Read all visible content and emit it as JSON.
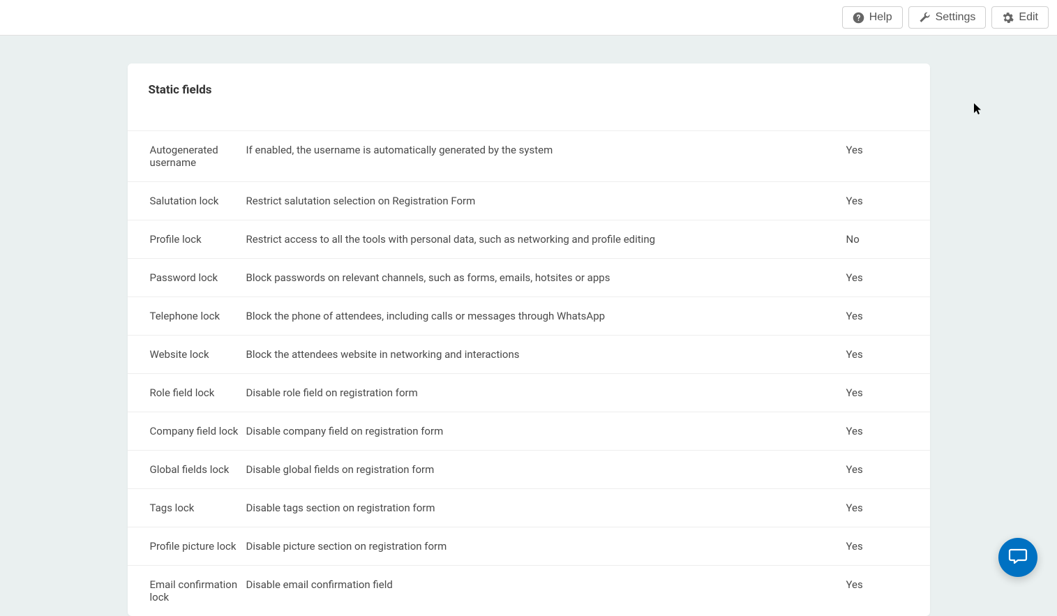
{
  "toolbar": {
    "help_label": "Help",
    "settings_label": "Settings",
    "edit_label": "Edit"
  },
  "card": {
    "title": "Static fields"
  },
  "fields": [
    {
      "name": "Autogenerated username",
      "description": "If enabled, the username is automatically generated by the system",
      "value": "Yes"
    },
    {
      "name": "Salutation lock",
      "description": "Restrict salutation selection on Registration Form",
      "value": "Yes"
    },
    {
      "name": "Profile lock",
      "description": "Restrict access to all the tools with personal data, such as networking and profile editing",
      "value": "No"
    },
    {
      "name": "Password lock",
      "description": "Block passwords on relevant channels, such as forms, emails, hotsites or apps",
      "value": "Yes"
    },
    {
      "name": "Telephone lock",
      "description": "Block the phone of attendees, including calls or messages through WhatsApp",
      "value": "Yes"
    },
    {
      "name": "Website lock",
      "description": "Block the attendees website in networking and interactions",
      "value": "Yes"
    },
    {
      "name": "Role field lock",
      "description": "Disable role field on registration form",
      "value": "Yes"
    },
    {
      "name": "Company field lock",
      "description": "Disable company field on registration form",
      "value": "Yes"
    },
    {
      "name": "Global fields lock",
      "description": "Disable global fields on registration form",
      "value": "Yes"
    },
    {
      "name": "Tags lock",
      "description": "Disable tags section on registration form",
      "value": "Yes"
    },
    {
      "name": "Profile picture lock",
      "description": "Disable picture section on registration form",
      "value": "Yes"
    },
    {
      "name": "Email confirmation lock",
      "description": "Disable email confirmation field",
      "value": "Yes"
    }
  ],
  "colors": {
    "yes": "#198754",
    "no": "#dc3545",
    "chat": "#0071c2"
  }
}
